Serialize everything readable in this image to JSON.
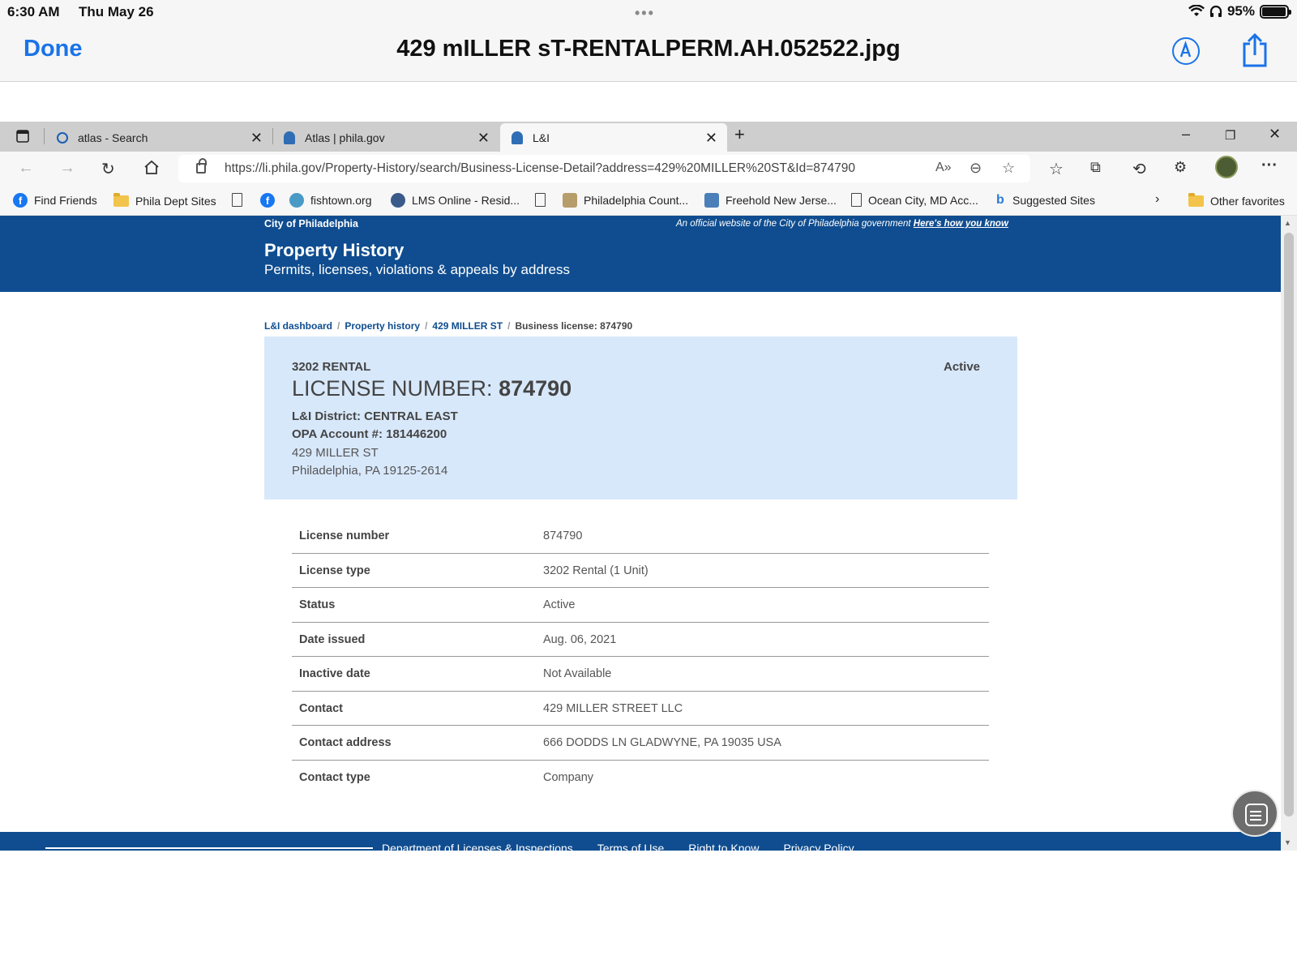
{
  "ios_status": {
    "time": "6:30 AM",
    "date": "Thu May 26",
    "battery": "95%"
  },
  "viewer": {
    "done_label": "Done",
    "title": "429 mILLER sT-RENTALPERM.AH.052522.jpg"
  },
  "browser": {
    "tabs": [
      {
        "label": "atlas - Search",
        "icon": "search-icon",
        "active": false
      },
      {
        "label": "Atlas | phila.gov",
        "icon": "liberty-bell-icon",
        "active": false
      },
      {
        "label": "L&I",
        "icon": "liberty-bell-icon",
        "active": true
      }
    ],
    "url": "https://li.phila.gov/Property-History/search/Business-License-Detail?address=429%20MILLER%20ST&Id=874790",
    "favorites": [
      {
        "label": "Find Friends",
        "icon": "facebook-icon"
      },
      {
        "label": "Phila Dept Sites",
        "icon": "folder-icon"
      },
      {
        "label": "",
        "icon": "page-icon"
      },
      {
        "label": "",
        "icon": "facebook-icon"
      },
      {
        "label": "fishtown.org",
        "icon": "fishtown-icon"
      },
      {
        "label": "LMS Online - Resid...",
        "icon": "globe-icon"
      },
      {
        "label": "",
        "icon": "page-icon"
      },
      {
        "label": "Philadelphia Count...",
        "icon": "map-icon"
      },
      {
        "label": "Freehold New Jerse...",
        "icon": "map-icon"
      },
      {
        "label": "Ocean City, MD Acc...",
        "icon": "page-icon"
      },
      {
        "label": "Suggested Sites",
        "icon": "bing-icon"
      }
    ],
    "other_favorites": "Other favorites"
  },
  "page": {
    "city_label": "City of Philadelphia",
    "official_text": "An official website of the City of Philadelphia government",
    "official_link": "Here's how you know",
    "title": "Property History",
    "subtitle": "Permits, licenses, violations & appeals by address",
    "breadcrumb": {
      "items": [
        "L&I dashboard",
        "Property history",
        "429 MILLER ST"
      ],
      "sep": "/",
      "current": "Business license: 874790"
    },
    "license": {
      "type": "3202 RENTAL",
      "status": "Active",
      "number_label": "LICENSE NUMBER:",
      "number": "874790",
      "district": "L&I District: CENTRAL EAST",
      "opa": "OPA Account #: 181446200",
      "street": "429 MILLER ST",
      "city": "Philadelphia, PA 19125-2614"
    },
    "details": [
      {
        "label": "License number",
        "value": "874790"
      },
      {
        "label": "License type",
        "value": "3202 Rental (1 Unit)"
      },
      {
        "label": "Status",
        "value": "Active"
      },
      {
        "label": "Date issued",
        "value": "Aug. 06, 2021"
      },
      {
        "label": "Inactive date",
        "value": "Not Available"
      },
      {
        "label": "Contact",
        "value": "429 MILLER STREET LLC"
      },
      {
        "label": "Contact address",
        "value": "666 DODDS LN GLADWYNE, PA 19035 USA"
      },
      {
        "label": "Contact type",
        "value": "Company"
      }
    ],
    "footer_links": [
      "Department of Licenses & Inspections",
      "Terms of Use",
      "Right to Know",
      "Privacy Policy"
    ]
  },
  "colors": {
    "brand_blue": "#0f4d90",
    "card_bg": "#d8e8fb",
    "ios_blue": "#1a73e8"
  }
}
